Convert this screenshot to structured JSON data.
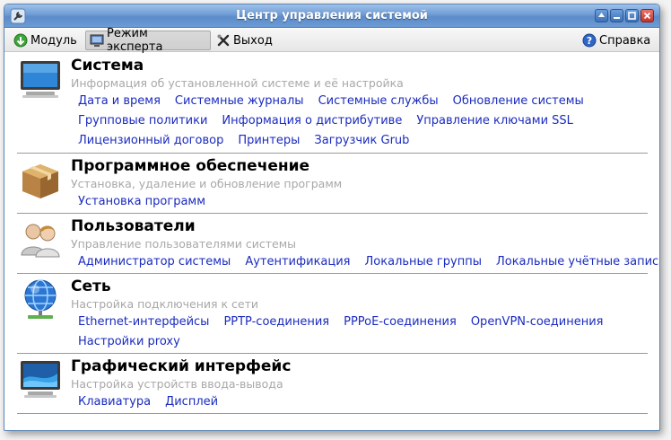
{
  "window": {
    "title": "Центр управления системой"
  },
  "toolbar": {
    "module": "Модуль",
    "expert": "Режим эксперта",
    "exit": "Выход",
    "help": "Справка"
  },
  "sections": [
    {
      "title": "Система",
      "description": "Информация об установленной системе и её настройка",
      "links": [
        [
          "Дата и время",
          "Системные журналы",
          "Системные службы",
          "Обновление системы"
        ],
        [
          "Групповые политики",
          "Информация о дистрибутиве",
          "Управление ключами SSL"
        ],
        [
          "Лицензионный договор",
          "Принтеры",
          "Загрузчик Grub"
        ]
      ]
    },
    {
      "title": "Программное обеспечение",
      "description": "Установка, удаление и обновление программ",
      "links": [
        [
          "Установка программ"
        ]
      ]
    },
    {
      "title": "Пользователи",
      "description": "Управление пользователями системы",
      "links": [
        [
          "Администратор системы",
          "Аутентификация",
          "Локальные группы",
          "Локальные учётные записи"
        ]
      ]
    },
    {
      "title": "Сеть",
      "description": "Настройка подключения к сети",
      "links": [
        [
          "Ethernet-интерфейсы",
          "PPTP-соединения",
          "PPPoE-соединения",
          "OpenVPN-соединения"
        ],
        [
          "Настройки proxy"
        ]
      ]
    },
    {
      "title": "Графический интерфейс",
      "description": "Настройка устройств ввода-вывода",
      "links": [
        [
          "Клавиатура",
          "Дисплей"
        ]
      ]
    }
  ]
}
